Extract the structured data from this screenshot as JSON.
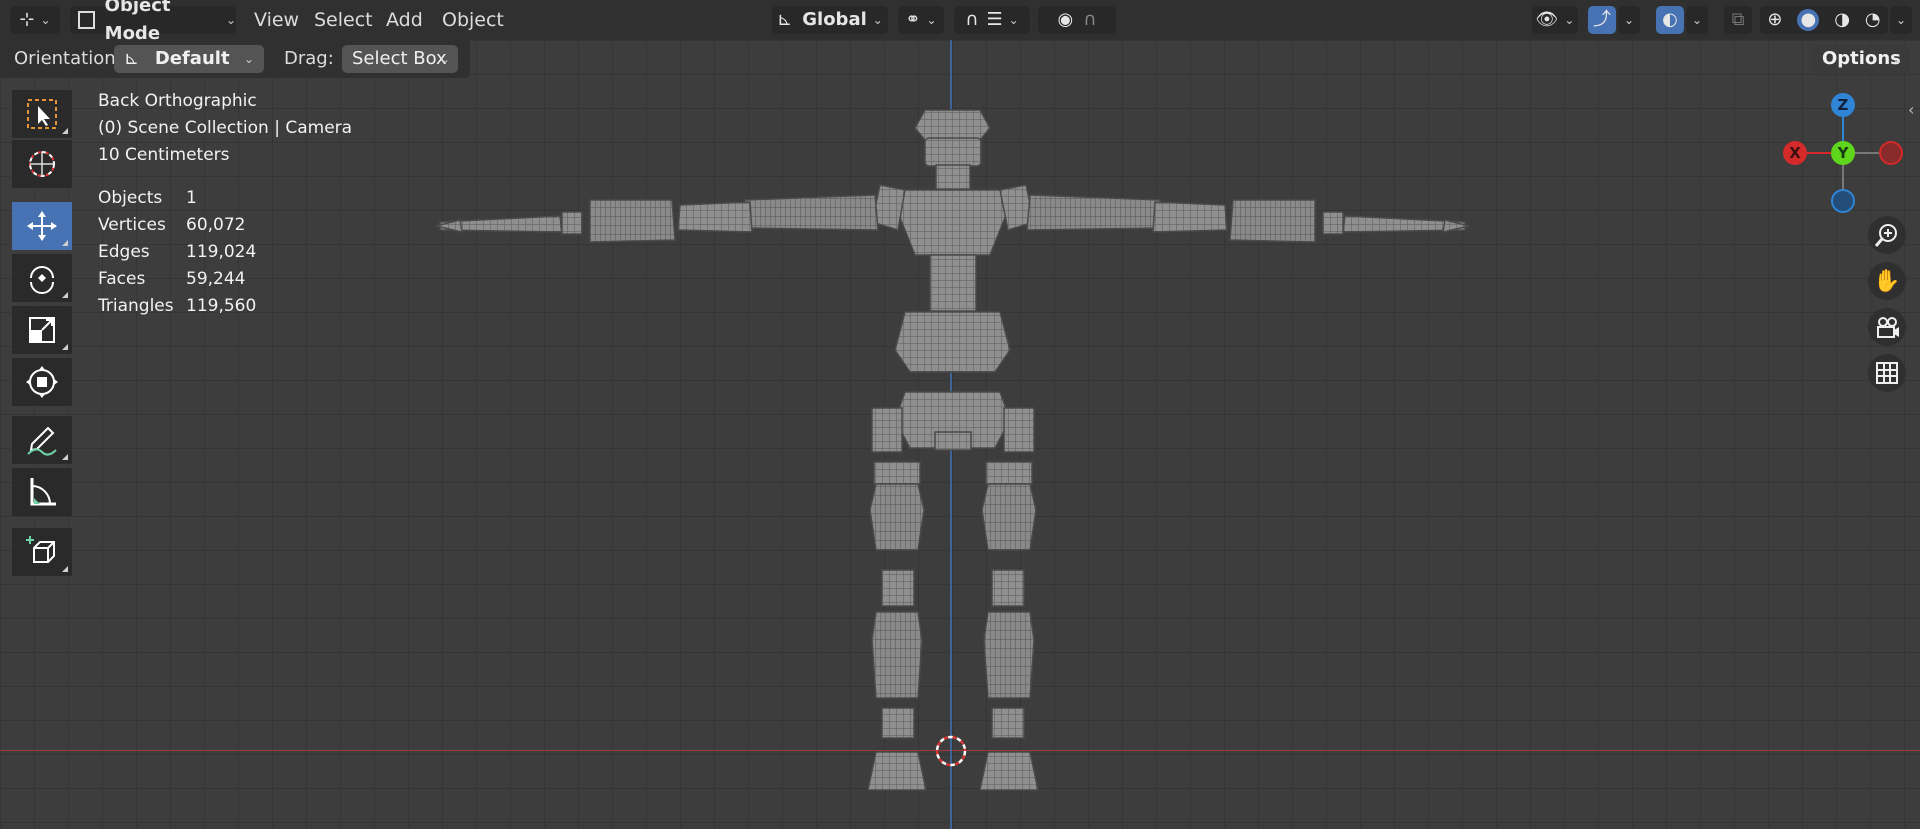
{
  "header": {
    "editor_type_icon": "axes-editor-icon",
    "mode_label": "Object Mode",
    "menus": [
      "View",
      "Select",
      "Add",
      "Object"
    ],
    "transform_orientation": "Global",
    "pivot_icon": "link-pivot-icon",
    "snap_icon": "magnet-icon",
    "proportional_icon": "proportional-edit-icon",
    "falloff_icon": "falloff-curve-icon",
    "visibility_icon": "eye-icon",
    "gizmo_icon": "gizmo-toggle-icon",
    "overlay_icon": "overlay-toggle-icon",
    "xray_icon": "xray-icon",
    "shading_icons": [
      "wireframe-shading-icon",
      "solid-shading-icon",
      "material-shading-icon",
      "rendered-shading-icon"
    ]
  },
  "tool_settings": {
    "orientation_label": "Orientation:",
    "orientation_value": "Default",
    "drag_label": "Drag:",
    "drag_value": "Select Box",
    "options_label": "Options"
  },
  "toolbar": [
    {
      "name": "select-box-tool",
      "icon": "select-box-icon",
      "active": false
    },
    {
      "name": "cursor-tool",
      "icon": "cursor-icon",
      "active": false
    },
    {
      "name": "move-tool",
      "icon": "move-icon",
      "active": true
    },
    {
      "name": "rotate-tool",
      "icon": "rotate-icon",
      "active": false
    },
    {
      "name": "scale-tool",
      "icon": "scale-icon",
      "active": false
    },
    {
      "name": "transform-tool",
      "icon": "transform-icon",
      "active": false
    },
    {
      "name": "annotate-tool",
      "icon": "annotate-icon",
      "active": false
    },
    {
      "name": "measure-tool",
      "icon": "measure-icon",
      "active": false
    },
    {
      "name": "add-cube-tool",
      "icon": "add-cube-icon",
      "active": false
    }
  ],
  "overlay": {
    "view_name": "Back Orthographic",
    "collection": "(0) Scene Collection | Camera",
    "grid_scale": "10 Centimeters",
    "stats": [
      {
        "label": "Objects",
        "value": "1"
      },
      {
        "label": "Vertices",
        "value": "60,072"
      },
      {
        "label": "Edges",
        "value": "119,024"
      },
      {
        "label": "Faces",
        "value": "59,244"
      },
      {
        "label": "Triangles",
        "value": "119,560"
      }
    ]
  },
  "gizmo": {
    "z_label": "Z",
    "x_label": "X",
    "y_label": "Y",
    "z_color": "#2f84d6",
    "x_color": "#d42a2a",
    "y_color": "#5fd61c"
  },
  "nav_buttons": [
    "zoom-icon",
    "hand-pan-icon",
    "camera-view-icon",
    "ortho-grid-icon"
  ],
  "colors": {
    "accent": "#4772b3",
    "viewport_bg": "#3d3d3d",
    "header_bg": "#303030",
    "mesh": "#8c8c8c"
  }
}
